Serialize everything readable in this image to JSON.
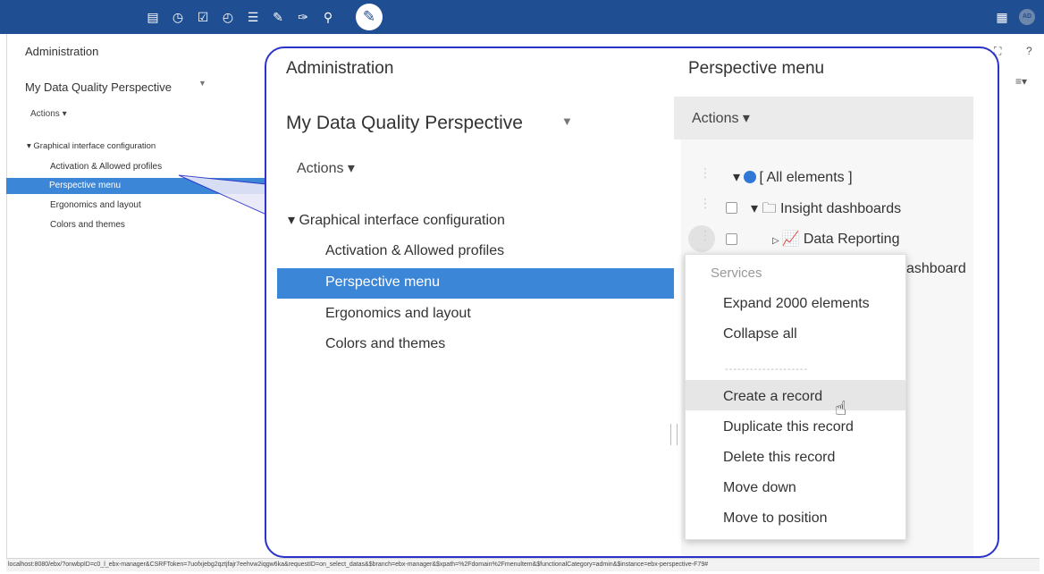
{
  "topbar": {
    "icons": [
      "database-icon",
      "clock-icon",
      "check-square-icon",
      "dashboard-icon",
      "stack-icon",
      "edit-check-icon",
      "plug-icon",
      "search-icon"
    ],
    "active_icon": "wrench-icon",
    "right_icon": "grid-icon",
    "avatar_initials": "AD"
  },
  "left_panel": {
    "title": "Administration",
    "perspective_name": "My Data Quality Perspective",
    "actions_label": "Actions ▾",
    "tree_group": "▾ Graphical interface configuration",
    "items": [
      "Activation & Allowed profiles",
      "Perspective menu",
      "Ergonomics and layout",
      "Colors and themes"
    ],
    "selected_item": "Perspective menu"
  },
  "right_tools": {
    "fullscreen": "⛶",
    "help": "?",
    "menu": "≡▾"
  },
  "zoom": {
    "left": {
      "title": "Administration",
      "perspective_name": "My Data Quality Perspective",
      "actions_label": "Actions ▾",
      "tree_group": "Graphical interface configuration",
      "items": [
        "Activation & Allowed profiles",
        "Perspective menu",
        "Ergonomics and layout",
        "Colors and themes"
      ]
    },
    "right": {
      "title": "Perspective menu",
      "actions_label": "Actions ▾",
      "tree": {
        "root": "[ All elements ]",
        "folder": "Insight dashboards",
        "chart_item": "Data Reporting",
        "truncated_item": "ashboard"
      },
      "context_menu": {
        "heading": "Services",
        "items": [
          "Expand 2000 elements",
          "Collapse all",
          "Create a record",
          "Duplicate this record",
          "Delete this record",
          "Move down",
          "Move to position"
        ],
        "separator": "--------------------",
        "hovered": "Create a record"
      }
    }
  },
  "status_bar": {
    "url": "localhost:8080/ebx/?onwbpID=c0_l_ebx-manager&CSRFToken=7uofxjebg2qztjfajr7eehvw2iqgw6ka&requestID=on_select_datas&$branch=ebx-manager&$xpath=%2Fdomain%2Fmenultem&$functionalCategory=admin&$instance=ebx-perspective-F79#"
  }
}
